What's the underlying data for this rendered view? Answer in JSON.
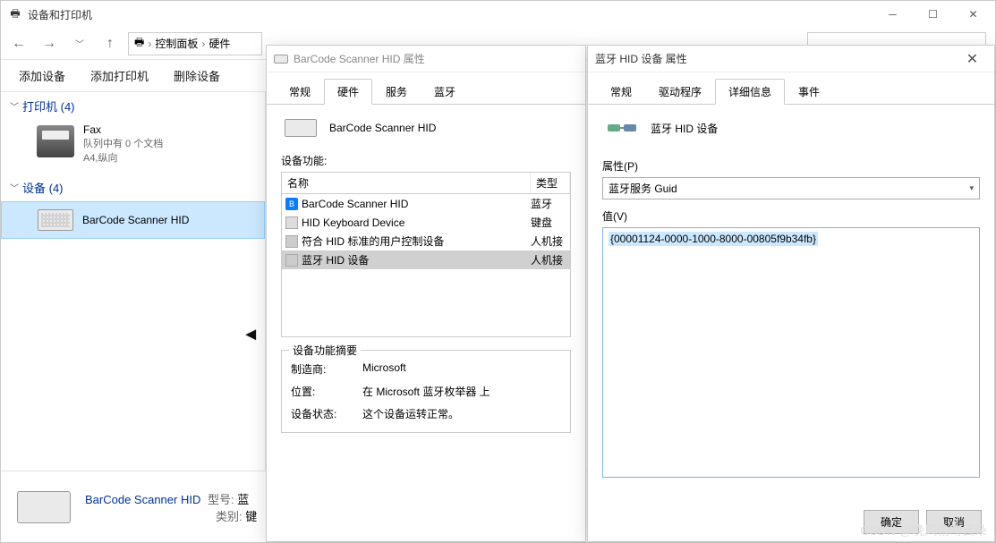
{
  "explorer": {
    "title": "设备和打印机",
    "breadcrumb": {
      "p1": "控制面板",
      "p2": "硬件"
    },
    "toolbar": {
      "add_device": "添加设备",
      "add_printer": "添加打印机",
      "remove_device": "删除设备"
    },
    "groups": {
      "printers": {
        "label": "打印机 (4)"
      },
      "devices": {
        "label": "设备 (4)"
      }
    },
    "printer": {
      "name": "Fax",
      "queue": "队列中有 0 个文档",
      "paper": "A4,纵向"
    },
    "device": {
      "name": "BarCode Scanner HID"
    },
    "detail": {
      "name": "BarCode Scanner HID",
      "type_label": "型号:",
      "type_val": "蓝",
      "cat_label": "类别:",
      "cat_val": "键"
    }
  },
  "dlg1": {
    "title": "BarCode Scanner HID 属性",
    "tabs": {
      "general": "常规",
      "hardware": "硬件",
      "service": "服务",
      "bluetooth": "蓝牙"
    },
    "device_name": "BarCode Scanner HID",
    "func_label": "设备功能:",
    "columns": {
      "name": "名称",
      "type": "类型"
    },
    "rows": [
      {
        "name": "BarCode Scanner HID",
        "type": "蓝牙",
        "icon": "bt"
      },
      {
        "name": "HID Keyboard Device",
        "type": "键盘",
        "icon": "kb"
      },
      {
        "name": "符合 HID 标准的用户控制设备",
        "type": "人机接",
        "icon": "hi"
      },
      {
        "name": "蓝牙 HID 设备",
        "type": "人机接",
        "icon": "hi",
        "selected": true
      }
    ],
    "summary": {
      "legend": "设备功能摘要",
      "vendor_k": "制造商:",
      "vendor_v": "Microsoft",
      "loc_k": "位置:",
      "loc_v": "在 Microsoft 蓝牙枚举器 上",
      "status_k": "设备状态:",
      "status_v": "这个设备运转正常。"
    }
  },
  "dlg2": {
    "title": "蓝牙 HID 设备 属性",
    "tabs": {
      "general": "常规",
      "driver": "驱动程序",
      "details": "详细信息",
      "events": "事件"
    },
    "device_name": "蓝牙 HID 设备",
    "prop_label": "属性(P)",
    "prop_value": "蓝牙服务 Guid",
    "val_label": "值(V)",
    "val_value": "{00001124-0000-1000-8000-00805f9b34fb}",
    "ok": "确定",
    "cancel": "取消"
  },
  "watermark": "CSDN @晚风偷吻云朵"
}
